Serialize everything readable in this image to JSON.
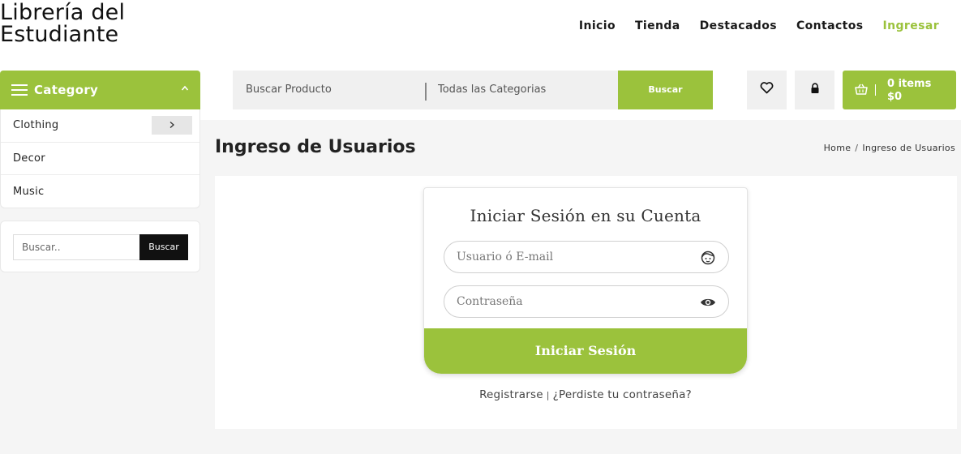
{
  "brand": {
    "line1": "Librería del",
    "line2": "Estudiante"
  },
  "nav": [
    {
      "label": "Inicio"
    },
    {
      "label": "Tienda"
    },
    {
      "label": "Destacados"
    },
    {
      "label": "Contactos"
    },
    {
      "label": "Ingresar",
      "active": true
    }
  ],
  "category": {
    "title": "Category",
    "items": [
      {
        "label": "Clothing",
        "has_submenu": true
      },
      {
        "label": "Decor"
      },
      {
        "label": "Music"
      }
    ]
  },
  "search": {
    "placeholder": "Buscar Producto",
    "category_select": "Todas las Categorias",
    "button": "Buscar"
  },
  "cart": {
    "items": "0 items",
    "total": "$0"
  },
  "side_search": {
    "placeholder": "Buscar..",
    "button": "Buscar"
  },
  "page": {
    "title": "Ingreso de Usuarios",
    "breadcrumb": {
      "home": "Home",
      "sep": "/",
      "current": "Ingreso de Usuarios"
    }
  },
  "login": {
    "title": "Iniciar Sesión en su Cuenta",
    "user_placeholder": "Usuario ó E-mail",
    "password_placeholder": "Contraseña",
    "submit": "Iniciar Sesión",
    "register_link": "Registrarse",
    "links_separator": "|",
    "forgot_link": "¿Perdiste tu contraseña?"
  },
  "colors": {
    "accent": "#9bc23c",
    "dark": "#111111",
    "panel_bg": "#f0f0f0"
  },
  "icons": {
    "wishlist": "heart-icon",
    "account": "lock-icon",
    "cart": "basket-icon",
    "user_field": "face-icon",
    "password_field": "eye-icon"
  }
}
